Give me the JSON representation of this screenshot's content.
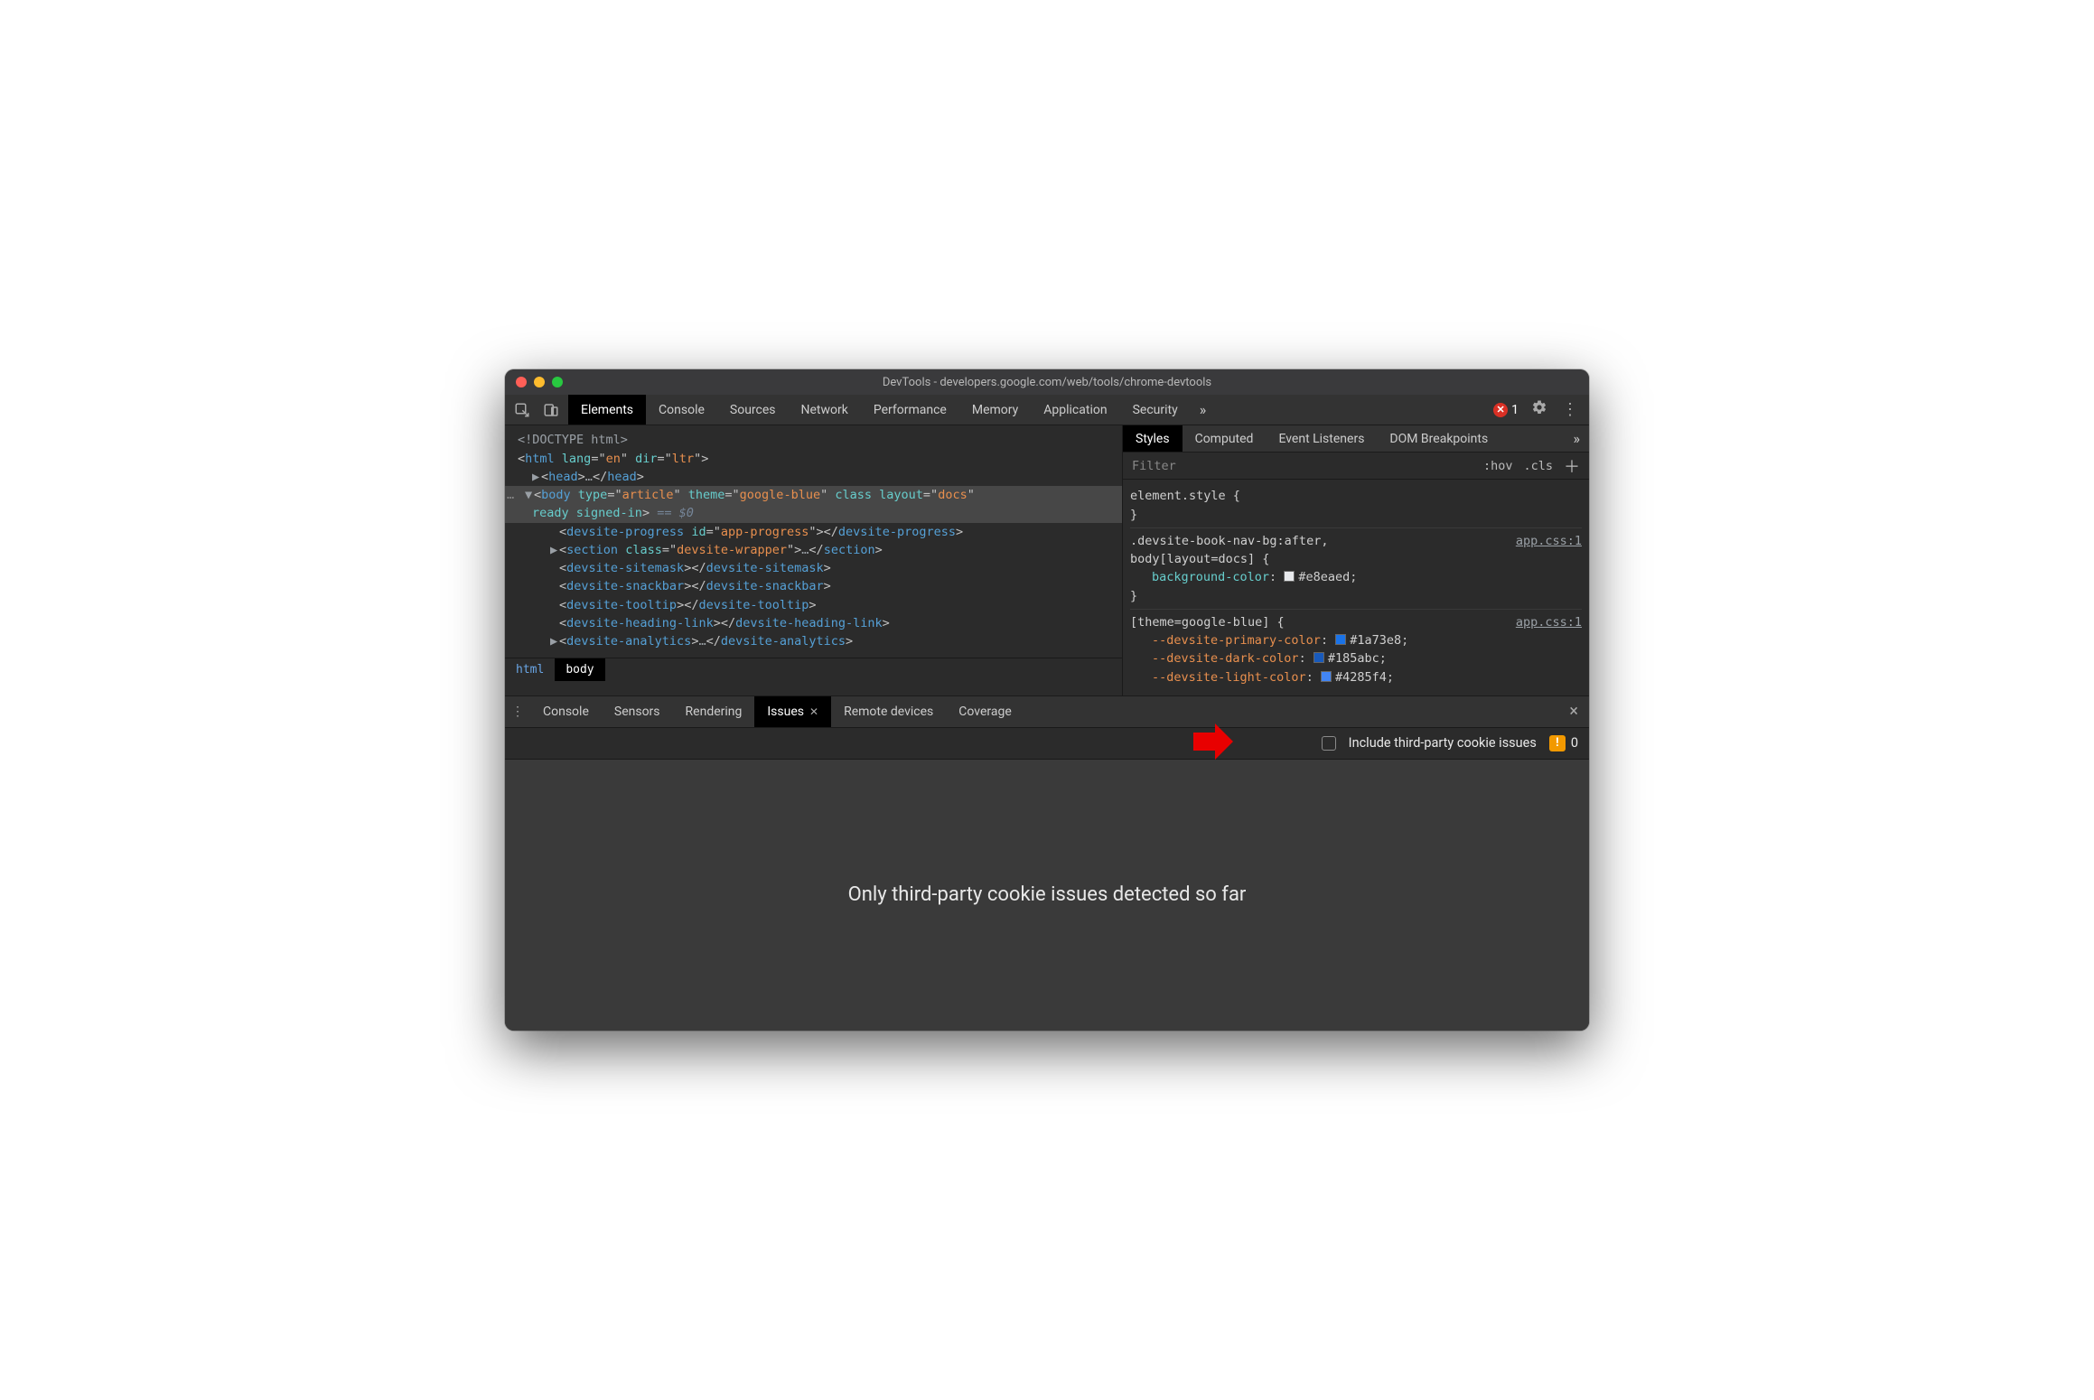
{
  "titlebar": {
    "title": "DevTools - developers.google.com/web/tools/chrome-devtools"
  },
  "mainTabs": {
    "items": [
      "Elements",
      "Console",
      "Sources",
      "Network",
      "Performance",
      "Memory",
      "Application",
      "Security"
    ],
    "more": "»",
    "activeIndex": 0,
    "errorCount": "1"
  },
  "dom": {
    "lines": {
      "doctype": "<!DOCTYPE html>",
      "htmlOpen": {
        "tag": "html",
        "attrs": [
          [
            "lang",
            "en"
          ],
          [
            "dir",
            "ltr"
          ]
        ]
      },
      "headCollapsed": {
        "open": "<head>",
        "ell": "…",
        "close": "</head>"
      },
      "bodyOpen": {
        "tag": "body",
        "attrs": [
          [
            "type",
            "article"
          ],
          [
            "theme",
            "google-blue"
          ]
        ],
        "bareAttrs": [
          "class"
        ],
        "attrs2": [
          [
            "layout",
            "docs"
          ]
        ],
        "secondRow": [
          "ready",
          "signed-in"
        ],
        "eqZero": " == $0"
      },
      "children": [
        {
          "open": "<devsite-progress",
          "attrs": [
            [
              "id",
              "app-progress"
            ]
          ],
          "close": "></devsite-progress>"
        },
        {
          "tri": "▶",
          "open": "<section",
          "attrs": [
            [
              "class",
              "devsite-wrapper"
            ]
          ],
          "closeOpen": ">",
          "ell": "…",
          "close": "</section>"
        },
        {
          "open": "<devsite-sitemask>",
          "close": "</devsite-sitemask>"
        },
        {
          "open": "<devsite-snackbar>",
          "close": "</devsite-snackbar>"
        },
        {
          "open": "<devsite-tooltip>",
          "close": "</devsite-tooltip>"
        },
        {
          "open": "<devsite-heading-link>",
          "close": "</devsite-heading-link>"
        },
        {
          "tri": "▶",
          "open": "<devsite-analytics>",
          "ell": "…",
          "close": "</devsite-analytics>"
        }
      ]
    },
    "breadcrumb": [
      "html",
      "body"
    ],
    "breadcrumbActive": 1
  },
  "stylesPanel": {
    "tabs": [
      "Styles",
      "Computed",
      "Event Listeners",
      "DOM Breakpoints"
    ],
    "more": "»",
    "activeIndex": 0,
    "filterPlaceholder": "Filter",
    "hov": ":hov",
    "cls": ".cls",
    "rules": [
      {
        "selector": "element.style {",
        "props": [],
        "close": "}"
      },
      {
        "selector": ".devsite-book-nav-bg:after,",
        "selector2": "body[layout=docs] {",
        "source": "app.css:1",
        "props": [
          {
            "name": "background-color",
            "value": "#e8eaed",
            "swatch": "#e8eaed"
          }
        ],
        "close": "}"
      },
      {
        "selector": "[theme=google-blue] {",
        "source": "app.css:1",
        "props": [
          {
            "name": "--devsite-primary-color",
            "value": "#1a73e8",
            "swatch": "#1a73e8",
            "isVar": true
          },
          {
            "name": "--devsite-dark-color",
            "value": "#185abc",
            "swatch": "#185abc",
            "isVar": true
          },
          {
            "name": "--devsite-light-color",
            "value": "#4285f4",
            "swatch": "#4285f4",
            "isVar": true
          }
        ]
      }
    ]
  },
  "drawer": {
    "tabs": [
      "Console",
      "Sensors",
      "Rendering",
      "Issues",
      "Remote devices",
      "Coverage"
    ],
    "activeIndex": 3,
    "closeGlyph": "×"
  },
  "issues": {
    "checkboxLabel": "Include third-party cookie issues",
    "badgeCount": "0",
    "emptyMessage": "Only third-party cookie issues detected so far"
  }
}
